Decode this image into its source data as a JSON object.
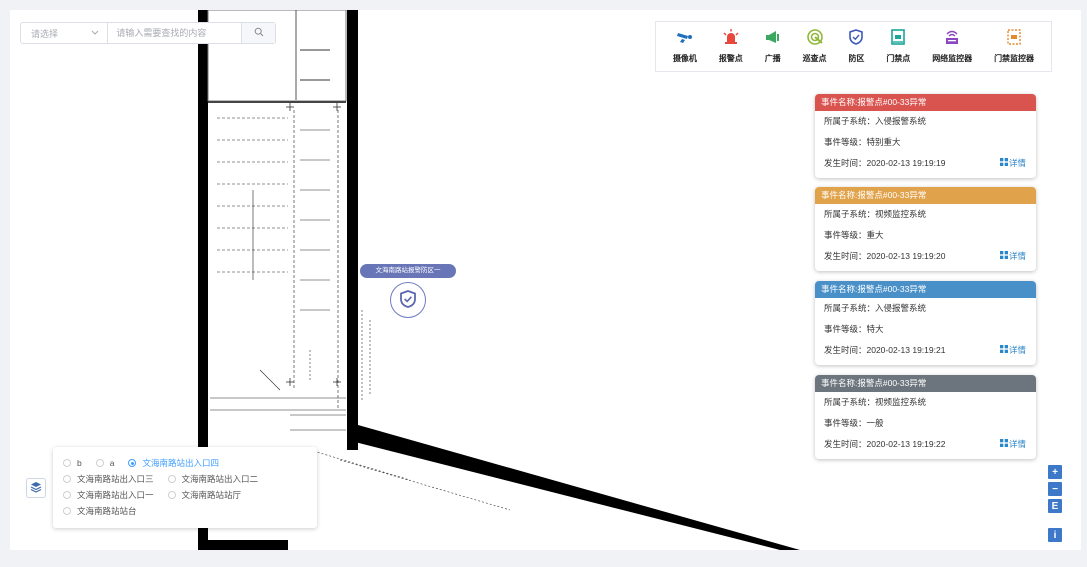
{
  "search": {
    "select_placeholder": "请选择",
    "input_placeholder": "请输入需要查找的内容"
  },
  "toolbar": {
    "items": [
      {
        "label": "摄像机",
        "icon": "camera-icon",
        "color": "#1f6fbf"
      },
      {
        "label": "报警点",
        "icon": "alarm-icon",
        "color": "#e8473c"
      },
      {
        "label": "广播",
        "icon": "megaphone-icon",
        "color": "#3aa860"
      },
      {
        "label": "巡查点",
        "icon": "patrol-icon",
        "color": "#8fb83a"
      },
      {
        "label": "防区",
        "icon": "shield-icon",
        "color": "#3f5bb5"
      },
      {
        "label": "门禁点",
        "icon": "access-point-icon",
        "color": "#1aa79a"
      },
      {
        "label": "网络监控器",
        "icon": "network-monitor-icon",
        "color": "#8b47c2"
      },
      {
        "label": "门禁监控器",
        "icon": "access-monitor-icon",
        "color": "#e38a2c"
      }
    ]
  },
  "events": [
    {
      "title": "事件名称:报警点#00-33异常",
      "subsystem": "所属子系统：入侵报警系统",
      "level": "事件等级：特别重大",
      "time": "发生时间：2020-02-13 19:19:19",
      "detail": "详情",
      "color": "#d9534f"
    },
    {
      "title": "事件名称:报警点#00-33异常",
      "subsystem": "所属子系统：视频监控系统",
      "level": "事件等级：重大",
      "time": "发生时间：2020-02-13 19:19:20",
      "detail": "详情",
      "color": "#e0a24a"
    },
    {
      "title": "事件名称:报警点#00-33异常",
      "subsystem": "所属子系统：入侵报警系统",
      "level": "事件等级：特大",
      "time": "发生时间：2020-02-13 19:19:21",
      "detail": "详情",
      "color": "#4a90c8"
    },
    {
      "title": "事件名称:报警点#00-33异常",
      "subsystem": "所属子系统：视频监控系统",
      "level": "事件等级：一般",
      "time": "发生时间：2020-02-13 19:19:22",
      "detail": "详情",
      "color": "#6c757d"
    }
  ],
  "marker": {
    "label": "文海南路站报警防区一",
    "icon": "shield-icon"
  },
  "layers": {
    "rows": [
      [
        "b",
        "a",
        "文海南路站出入口四"
      ],
      [
        "文海南路站出入口三",
        "文海南路站出入口二"
      ],
      [
        "文海南路站出入口一",
        "文海南路站站厅"
      ],
      [
        "文海南路站站台"
      ]
    ],
    "selected": "文海南路站出入口四"
  },
  "zoom": {
    "in": "+",
    "out": "−",
    "extent": "E",
    "info": "i"
  },
  "accent_color": "#409eff"
}
